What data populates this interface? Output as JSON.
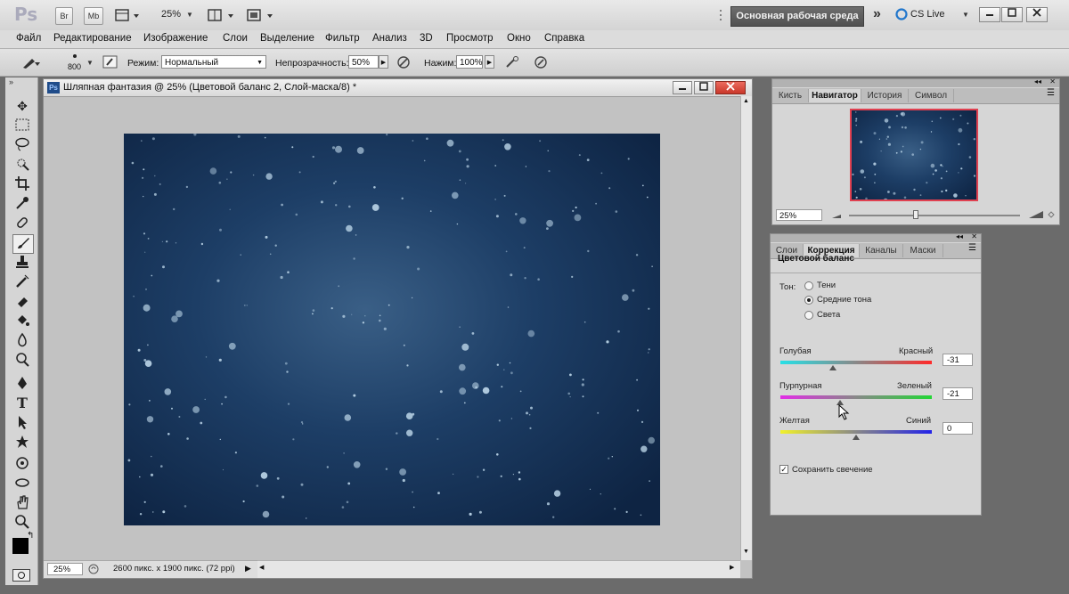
{
  "app": {
    "logo": "Ps",
    "bridge": "Br",
    "minibridge": "Mb",
    "zoom": "25%",
    "workspace": "Основная рабочая среда",
    "more": "»",
    "cslive": "CS Live"
  },
  "menu": [
    "Файл",
    "Редактирование",
    "Изображение",
    "Слои",
    "Выделение",
    "Фильтр",
    "Анализ",
    "3D",
    "Просмотр",
    "Окно",
    "Справка"
  ],
  "options": {
    "brush_size": "800",
    "mode_label": "Режим:",
    "mode_value": "Нормальный",
    "opacity_label": "Непрозрачность:",
    "opacity_value": "50%",
    "flow_label": "Нажим:",
    "flow_value": "100%"
  },
  "document": {
    "title": "Шляпная фантазия @ 25% (Цветовой баланс 2, Слой-маска/8) *",
    "status_zoom": "25%",
    "status_info": "2600 пикс. x 1900 пикс. (72 ppi)"
  },
  "navigator": {
    "tabs": [
      "Кисть",
      "Навигатор",
      "История",
      "Символ"
    ],
    "active_tab": "Навигатор",
    "zoom": "25%"
  },
  "adjustments": {
    "tabs": [
      "Слои",
      "Коррекция",
      "Каналы",
      "Маски"
    ],
    "active_tab": "Коррекция",
    "heading": "Цветовой баланс",
    "tone_label": "Тон:",
    "tones": [
      "Тени",
      "Средние тона",
      "Света"
    ],
    "selected_tone": "Средние тона",
    "sliders": [
      {
        "left": "Голубая",
        "right": "Красный",
        "value": "-31",
        "fraction": 0.345
      },
      {
        "left": "Пурпурная",
        "right": "Зеленый",
        "value": "-21",
        "fraction": 0.395
      },
      {
        "left": "Желтая",
        "right": "Синий",
        "value": "0",
        "fraction": 0.5
      }
    ],
    "preserve_label": "Сохранить свечение",
    "preserve_checked": true
  },
  "colors": {
    "canvas_dark": "#0e2443",
    "canvas_mid": "#1d3e66",
    "accent_frame": "#e04050"
  }
}
